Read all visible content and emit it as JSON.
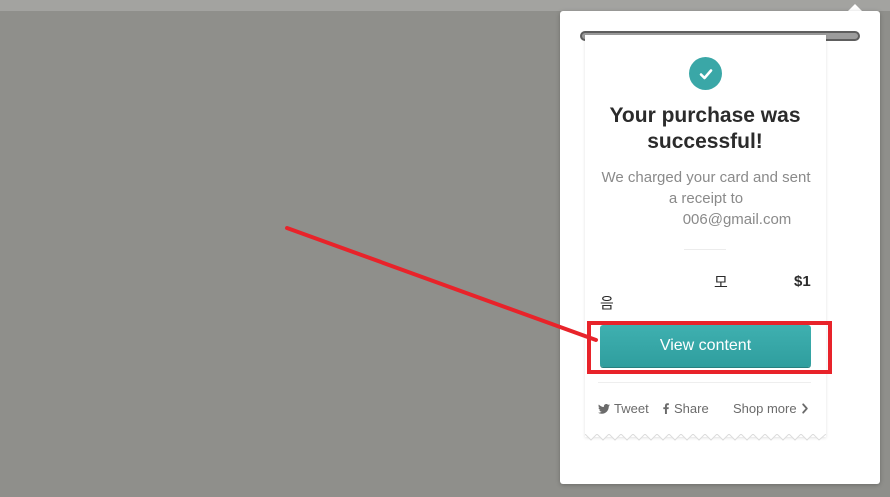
{
  "receipt": {
    "title": "Your purchase was successful!",
    "message_line1": "We charged your card and sent a receipt to",
    "email": "006@gmail.com",
    "item_name_part1": "모",
    "item_name_part2": "음",
    "price": "$1",
    "view_button_label": "View content"
  },
  "share_links": {
    "tweet": "Tweet",
    "share": "Share",
    "shop_more": "Shop more"
  },
  "colors": {
    "accent": "#3aa7a7",
    "annotation_red": "#e8232a",
    "overlay_gray": "#8f8f8b"
  },
  "icons": {
    "success": "check-icon",
    "twitter": "twitter-icon",
    "facebook": "facebook-icon",
    "chevron": "chevron-right-icon"
  }
}
